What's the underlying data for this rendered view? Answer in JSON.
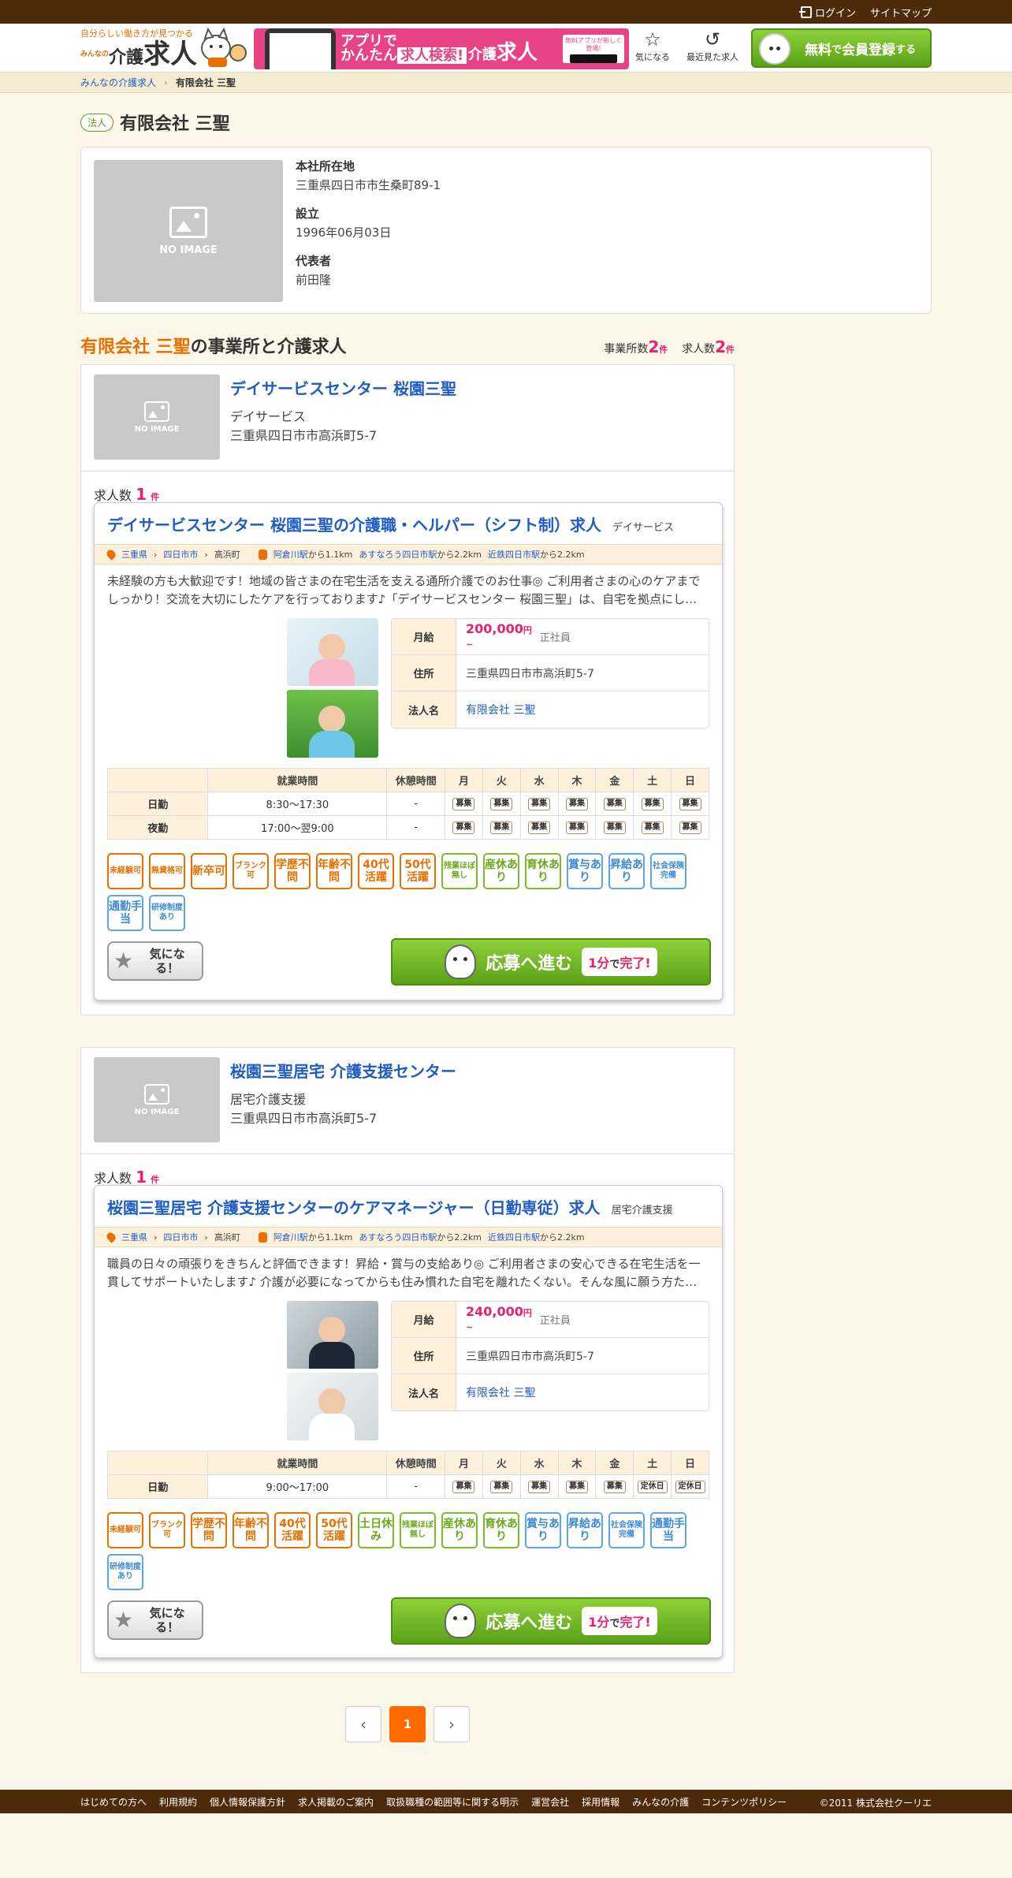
{
  "topbar": {
    "login": "ログイン",
    "sitemap": "サイトマップ"
  },
  "header": {
    "logo_tag": "自分らしい働き方が見つかる",
    "logo_mini": "みんなの",
    "logo_main1": "介護",
    "logo_main2": "求人",
    "banner_t1a": "アプリで",
    "banner_t1b": "かんたん",
    "banner_t1c": "求人検索!",
    "banner_t3": "無料アプリが新しく登場!",
    "fav": "気になる",
    "recent": "最近見た求人",
    "register_a": "無料",
    "register_b": "で",
    "register_c": "会員登録",
    "register_d": "する"
  },
  "breadcrumb": {
    "home": "みんなの介護求人",
    "current": "有限会社 三聖"
  },
  "company": {
    "badge": "法人",
    "name": "有限会社 三聖",
    "noimage": "NO IMAGE",
    "hq_label": "本社所在地",
    "hq": "三重県四日市市生桑町89-1",
    "founded_label": "設立",
    "founded": "1996年06月03日",
    "rep_label": "代表者",
    "rep": "前田隆"
  },
  "section": {
    "title_em": "有限会社 三聖",
    "title_rest": "の事業所と介護求人",
    "offices_label": "事業所数",
    "offices": "2",
    "jobs_label": "求人数",
    "jobs": "2",
    "unit": "件"
  },
  "offices": [
    {
      "name": "デイサービスセンター 桜園三聖",
      "type": "デイサービス",
      "address": "三重県四日市市高浜町5-7",
      "job_count_label": "求人数",
      "job_count": "1",
      "unit": "件",
      "job": {
        "title": "デイサービスセンター 桜園三聖の介護職・ヘルパー（シフト制）求人",
        "category": "デイサービス",
        "pref": "三重県",
        "city": "四日市市",
        "town": "高浜町",
        "st1": "阿倉川駅",
        "st1_dist": "から1.1km",
        "st2": "あすなろう四日市駅",
        "st2_dist": "から2.2km",
        "st3": "近鉄四日市駅",
        "st3_dist": "から2.2km",
        "desc": "未経験の方も大歓迎です！地域の皆さまの在宅生活を支える通所介護でのお仕事◎ ご利用者さまの心のケアまでしっかり！交流を大切にしたケアを行っております♪「デイサービスセンター 桜園三聖」は、自宅を拠点にし…",
        "salary_label": "月給",
        "salary": "200,000",
        "yen": "円",
        "tilde": "~",
        "employment": "正社員",
        "addr_label": "住所",
        "addr": "三重県四日市市高浜町5-7",
        "corp_label": "法人名",
        "corp": "有限会社 三聖"
      }
    },
    {
      "name": "桜園三聖居宅 介護支援センター",
      "type": "居宅介護支援",
      "address": "三重県四日市市高浜町5-7",
      "job_count_label": "求人数",
      "job_count": "1",
      "unit": "件",
      "job": {
        "title": "桜園三聖居宅 介護支援センターのケアマネージャー（日勤専従）求人",
        "category": "居宅介護支援",
        "pref": "三重県",
        "city": "四日市市",
        "town": "高浜町",
        "st1": "阿倉川駅",
        "st1_dist": "から1.1km",
        "st2": "あすなろう四日市駅",
        "st2_dist": "から2.2km",
        "st3": "近鉄四日市駅",
        "st3_dist": "から2.2km",
        "desc": "職員の日々の頑張りをきちんと評価できます！昇給・賞与の支給あり◎ ご利用者さまの安心できる在宅生活を一貫してサポートいたします♪ 介護が必要になってからも住み慣れた自宅を離れたくない。そんな風に願う方た…",
        "salary_label": "月給",
        "salary": "240,000",
        "yen": "円",
        "tilde": "~",
        "employment": "正社員",
        "addr_label": "住所",
        "addr": "三重県四日市市高浜町5-7",
        "corp_label": "法人名",
        "corp": "有限会社 三聖"
      }
    }
  ],
  "schedule_headers": [
    "",
    "就業時間",
    "休憩時間",
    "月",
    "火",
    "水",
    "木",
    "金",
    "土",
    "日"
  ],
  "schedule1": [
    {
      "label": "日勤",
      "hours": "8:30～17:30",
      "break": "-",
      "days": [
        "募集",
        "募集",
        "募集",
        "募集",
        "募集",
        "募集",
        "募集"
      ]
    },
    {
      "label": "夜勤",
      "hours": "17:00～翌9:00",
      "break": "-",
      "days": [
        "募集",
        "募集",
        "募集",
        "募集",
        "募集",
        "募集",
        "募集"
      ]
    }
  ],
  "schedule2": [
    {
      "label": "日勤",
      "hours": "9:00～17:00",
      "break": "-",
      "days": [
        "募集",
        "募集",
        "募集",
        "募集",
        "募集",
        "定休日",
        "定休日"
      ]
    }
  ],
  "tags1": [
    {
      "t": "未経験可",
      "c": "o",
      "s": true
    },
    {
      "t": "無資格可",
      "c": "o",
      "s": true
    },
    {
      "t": "新卒可",
      "c": "o"
    },
    {
      "t": "ブランク可",
      "c": "o",
      "s": true
    },
    {
      "t": "学歴不問",
      "c": "o"
    },
    {
      "t": "年齢不問",
      "c": "o"
    },
    {
      "t": "40代活躍",
      "c": "o"
    },
    {
      "t": "50代活躍",
      "c": "o"
    },
    {
      "t": "残業ほぼ無し",
      "c": "g",
      "s": true
    },
    {
      "t": "産休あり",
      "c": "g"
    },
    {
      "t": "育休あり",
      "c": "g"
    },
    {
      "t": "賞与あり",
      "c": "bl"
    },
    {
      "t": "昇給あり",
      "c": "bl"
    },
    {
      "t": "社会保険完備",
      "c": "bl",
      "s": true
    },
    {
      "t": "通勤手当",
      "c": "bl"
    },
    {
      "t": "研修制度あり",
      "c": "bl",
      "s": true
    }
  ],
  "tags2": [
    {
      "t": "未経験可",
      "c": "o",
      "s": true
    },
    {
      "t": "ブランク可",
      "c": "o",
      "s": true
    },
    {
      "t": "学歴不問",
      "c": "o"
    },
    {
      "t": "年齢不問",
      "c": "o"
    },
    {
      "t": "40代活躍",
      "c": "o"
    },
    {
      "t": "50代活躍",
      "c": "o"
    },
    {
      "t": "土日休み",
      "c": "g"
    },
    {
      "t": "残業ほぼ無し",
      "c": "g",
      "s": true
    },
    {
      "t": "産休あり",
      "c": "g"
    },
    {
      "t": "育休あり",
      "c": "g"
    },
    {
      "t": "賞与あり",
      "c": "bl"
    },
    {
      "t": "昇給あり",
      "c": "bl"
    },
    {
      "t": "社会保険完備",
      "c": "bl",
      "s": true
    },
    {
      "t": "通勤手当",
      "c": "bl"
    },
    {
      "t": "研修制度あり",
      "c": "bl",
      "s": true
    }
  ],
  "buttons": {
    "fav": "気になる！",
    "apply": "応募へ進む",
    "bubble_a": "1分",
    "bubble_b": "で",
    "bubble_c": "完了!"
  },
  "pager": {
    "current": "1"
  },
  "footer": {
    "links": [
      "はじめての方へ",
      "利用規約",
      "個人情報保護方針",
      "求人掲載のご案内",
      "取扱職種の範囲等に関する明示",
      "運営会社",
      "採用情報",
      "みんなの介護",
      "コンテンツポリシー"
    ],
    "copyright": "©2011 株式会社クーリエ"
  }
}
